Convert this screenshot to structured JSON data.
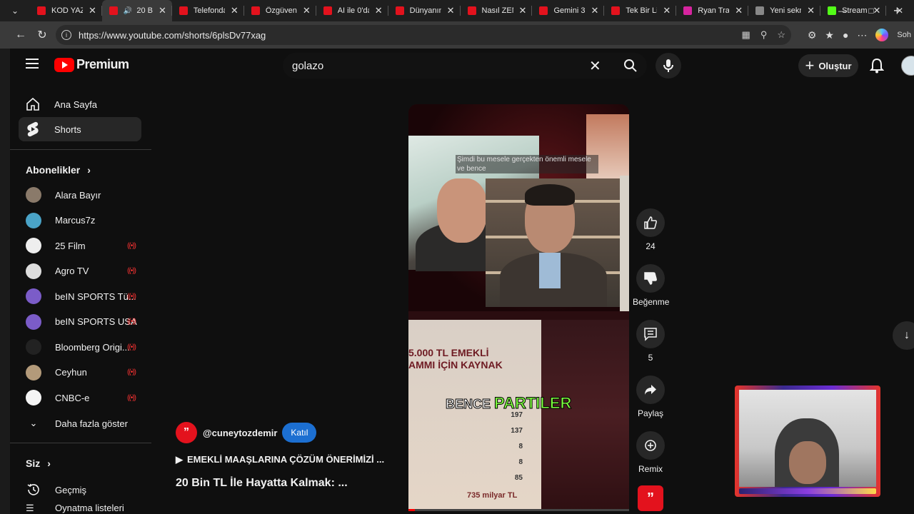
{
  "browser": {
    "tabs": [
      {
        "label": "KOD YAZ",
        "favicon_color": "#e3121d",
        "active": false
      },
      {
        "label": "20 B",
        "favicon_color": "#e3121d",
        "active": true
      },
      {
        "label": "Telefonda",
        "favicon_color": "#e3121d",
        "active": false
      },
      {
        "label": "Özgüven",
        "favicon_color": "#e3121d",
        "active": false
      },
      {
        "label": "AI ile 0'da",
        "favicon_color": "#e3121d",
        "active": false
      },
      {
        "label": "Dünyanın",
        "favicon_color": "#e3121d",
        "active": false
      },
      {
        "label": "Nasıl ZEN",
        "favicon_color": "#e3121d",
        "active": false
      },
      {
        "label": "Gemini 3",
        "favicon_color": "#e3121d",
        "active": false
      },
      {
        "label": "Tek Bir Li",
        "favicon_color": "#e3121d",
        "active": false
      },
      {
        "label": "Ryan Tra",
        "favicon_color": "#d6249f",
        "active": false
      },
      {
        "label": "Yeni sekm",
        "favicon_color": "#888888",
        "active": false
      },
      {
        "label": "Stream",
        "favicon_color": "#53fc18",
        "active": false
      }
    ],
    "url": "https://www.youtube.com/shorts/6plsDv77xag",
    "copilot_label": "Soh"
  },
  "youtube": {
    "brand": "Premium",
    "search_value": "golazo",
    "create_label": "Oluştur",
    "sidebar": {
      "main": [
        {
          "label": "Ana Sayfa",
          "icon": "home-icon"
        },
        {
          "label": "Shorts",
          "icon": "shorts-icon",
          "active": true
        }
      ],
      "subs_header": "Abonelikler",
      "subs": [
        {
          "label": "Alara Bayır",
          "color": "#8a7a6a",
          "live": false
        },
        {
          "label": "Marcus7z",
          "color": "#4aa3c7",
          "live": false
        },
        {
          "label": "25 Film",
          "color": "#eeeeee",
          "live": true
        },
        {
          "label": "Agro TV",
          "color": "#dddddd",
          "live": true
        },
        {
          "label": "beIN SPORTS Tü...",
          "color": "#7b5cc8",
          "live": true
        },
        {
          "label": "beIN SPORTS USA",
          "color": "#7b5cc8",
          "live": true
        },
        {
          "label": "Bloomberg Origi...",
          "color": "#222222",
          "live": true
        },
        {
          "label": "Ceyhun",
          "color": "#b39a7a",
          "live": true
        },
        {
          "label": "CNBC-e",
          "color": "#f4f4f4",
          "live": true
        }
      ],
      "show_more": "Daha fazla göster",
      "you_header": "Siz",
      "history": "Geçmiş",
      "playlists": "Oynatma listeleri"
    },
    "short": {
      "caption_top": "Şimdi bu mesele gerçekten önemli mesele ve bence",
      "overlay_word1": "BENCE",
      "overlay_word2": "PARTILER",
      "doc_title_line1": "5.000 TL EMEKLİ",
      "doc_title_line2": "AMMI İÇİN KAYNAK",
      "doc_values": [
        "197",
        "137",
        "8",
        "8",
        "85"
      ],
      "doc_total": "735 milyar TL",
      "progress_fraction": 0.03
    },
    "actions": {
      "likes": "24",
      "dislike_label": "Beğenme",
      "comments": "5",
      "share_label": "Paylaş",
      "remix_label": "Remix"
    },
    "meta": {
      "channel": "@cuneytozdemir",
      "join_label": "Katıl",
      "music": "EMEKLİ MAAŞLARINA ÇÖZÜM ÖNERİMİZİ ...",
      "title": "20 Bin TL İle Hayatta Kalmak: ..."
    }
  }
}
